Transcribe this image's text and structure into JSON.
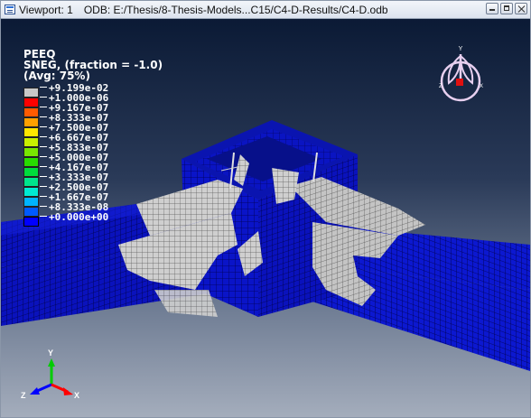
{
  "titlebar": {
    "viewport_label": "Viewport: 1",
    "odb_path": "ODB: E:/Thesis/8-Thesis-Models...C15/C4-D-Results/C4-D.odb"
  },
  "legend": {
    "line1": "PEEQ",
    "line2": "SNEG, (fraction = -1.0)",
    "line3": "(Avg: 75%)",
    "entries": [
      {
        "value": "+9.199e-02",
        "color": "#c8c8c8"
      },
      {
        "value": "+1.000e-06",
        "color": "#ff0000"
      },
      {
        "value": "+9.167e-07",
        "color": "#ff5a00"
      },
      {
        "value": "+8.333e-07",
        "color": "#ffa000"
      },
      {
        "value": "+7.500e-07",
        "color": "#ffe600"
      },
      {
        "value": "+6.667e-07",
        "color": "#c8f000"
      },
      {
        "value": "+5.833e-07",
        "color": "#78e600"
      },
      {
        "value": "+5.000e-07",
        "color": "#28dc00"
      },
      {
        "value": "+4.167e-07",
        "color": "#00dc3c"
      },
      {
        "value": "+3.333e-07",
        "color": "#00e68c"
      },
      {
        "value": "+2.500e-07",
        "color": "#00ebd2"
      },
      {
        "value": "+1.667e-07",
        "color": "#00b4ff"
      },
      {
        "value": "+8.333e-08",
        "color": "#005aff"
      },
      {
        "value": "+0.000e+00",
        "color": "#0000ff"
      }
    ]
  },
  "triad": {
    "y": "Y",
    "x": "X",
    "z": "Z"
  },
  "colors": {
    "mesh_blue": "#0a14c8",
    "yielded_gray": "#c8c8c8",
    "viewport_top": "#0b1a35",
    "viewport_bottom": "#a4adbc"
  }
}
